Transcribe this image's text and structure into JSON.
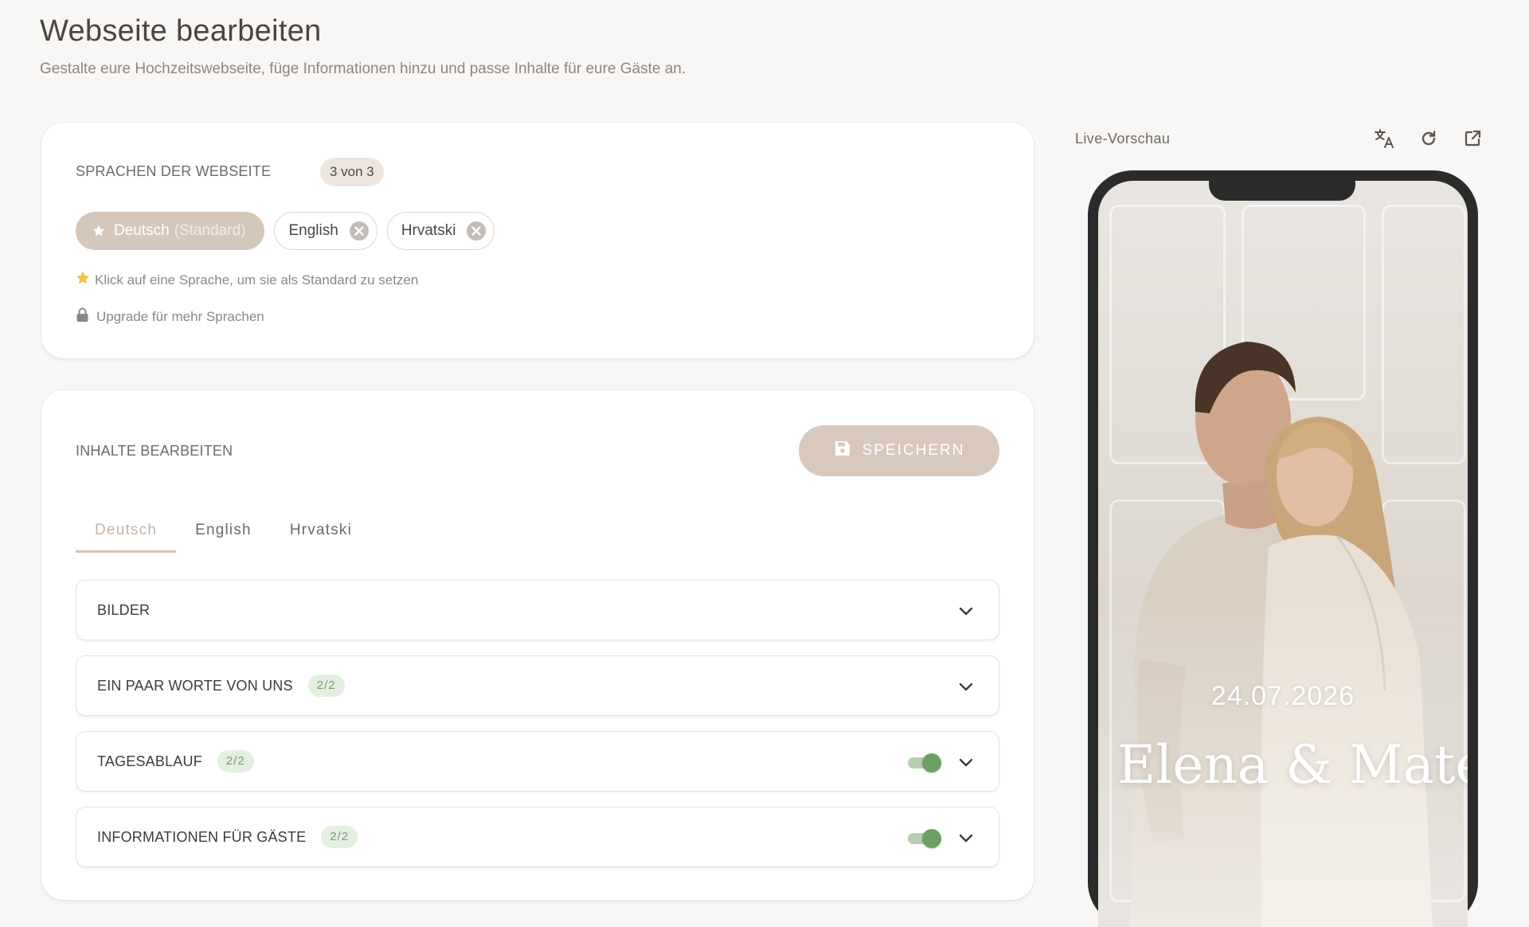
{
  "header": {
    "title": "Webseite bearbeiten",
    "subtitle": "Gestalte eure Hochzeitswebseite, füge Informationen hinzu und passe Inhalte für eure Gäste an."
  },
  "languages": {
    "section_label": "SPRACHEN DER WEBSEITE",
    "count_badge": "3 von 3",
    "default_language": {
      "name": "Deutsch",
      "suffix": "(Standard)"
    },
    "other_languages": [
      {
        "name": "English"
      },
      {
        "name": "Hrvatski"
      }
    ],
    "hint": "Klick auf eine Sprache, um sie als Standard zu setzen",
    "upgrade_label": "Upgrade für mehr Sprachen"
  },
  "content_editor": {
    "section_label": "INHALTE BEARBEITEN",
    "save_label": "SPEICHERN",
    "tabs": [
      {
        "label": "Deutsch",
        "active": true
      },
      {
        "label": "English",
        "active": false
      },
      {
        "label": "Hrvatski",
        "active": false
      }
    ],
    "sections": [
      {
        "title": "BILDER",
        "badge": "",
        "toggle_on": null
      },
      {
        "title": "EIN PAAR WORTE VON UNS",
        "badge": "2/2",
        "toggle_on": null
      },
      {
        "title": "TAGESABLAUF",
        "badge": "2/2",
        "toggle_on": true
      },
      {
        "title": "INFORMATIONEN FÜR GÄSTE",
        "badge": "2/2",
        "toggle_on": true
      }
    ]
  },
  "preview": {
    "label": "Live-Vorschau",
    "icons": [
      "translate-icon",
      "refresh-icon",
      "external-link-icon"
    ],
    "wedding_date": "24.07.2026",
    "couple_names": "Elena & Mateo"
  },
  "colors": {
    "accent": "#d6c7bb",
    "toggle_on": "#6fa063",
    "badge_green_bg": "#e4efe1",
    "badge_green_text": "#7b9a72"
  }
}
